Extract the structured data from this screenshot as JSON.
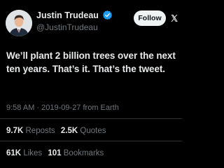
{
  "author": {
    "name": "Justin Trudeau",
    "handle": "@JustinTrudeau",
    "verified_icon": "verified-badge-icon",
    "verified_color": "#1d9bf0"
  },
  "follow_label": "Follow",
  "more_icon": "x-logo-icon",
  "tweet": {
    "text": "We’ll plant 2 billion trees over the next ten years. That’s it. That’s the tweet.",
    "time": "9:58 AM",
    "date": "2019-09-27",
    "source": "from Earth"
  },
  "stats": {
    "reposts_count": "9.7K",
    "reposts_label": "Reposts",
    "quotes_count": "2.5K",
    "quotes_label": "Quotes",
    "likes_count": "61K",
    "likes_label": "Likes",
    "bookmarks_count": "101",
    "bookmarks_label": "Bookmarks"
  },
  "colors": {
    "background": "#000000",
    "text": "#e7e9ea",
    "secondary_text": "#71767b",
    "divider": "#2f3336"
  }
}
